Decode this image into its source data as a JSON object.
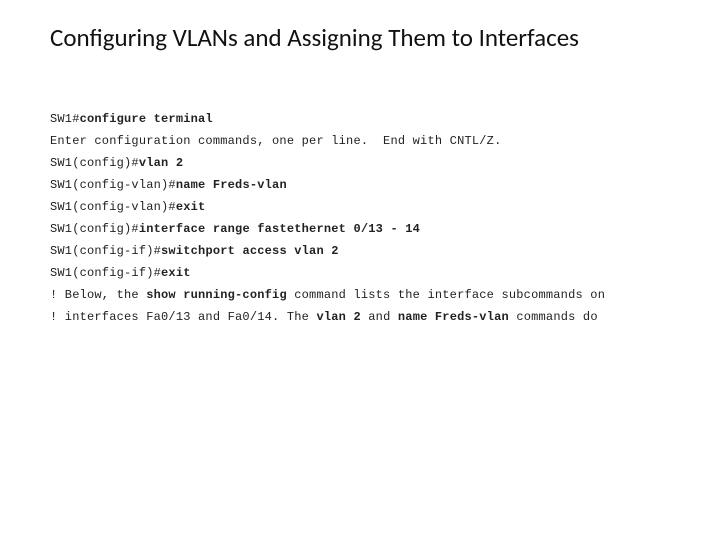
{
  "title": "Configuring VLANs and Assigning Them to Interfaces",
  "lines": [
    {
      "segments": [
        {
          "t": "SW1#"
        },
        {
          "t": "configure terminal",
          "b": true
        }
      ]
    },
    {
      "segments": [
        {
          "t": "Enter configuration commands, one per line.  End with CNTL/Z."
        }
      ]
    },
    {
      "segments": [
        {
          "t": "SW1(config)#"
        },
        {
          "t": "vlan 2",
          "b": true
        }
      ]
    },
    {
      "segments": [
        {
          "t": "SW1(config-vlan)#"
        },
        {
          "t": "name Freds-vlan",
          "b": true
        }
      ]
    },
    {
      "segments": [
        {
          "t": "SW1(config-vlan)#"
        },
        {
          "t": "exit",
          "b": true
        }
      ]
    },
    {
      "segments": [
        {
          "t": "SW1(config)#"
        },
        {
          "t": "interface range fastethernet 0/13 - 14",
          "b": true
        }
      ]
    },
    {
      "segments": [
        {
          "t": "SW1(config-if)#"
        },
        {
          "t": "switchport access vlan 2",
          "b": true
        }
      ]
    },
    {
      "segments": [
        {
          "t": "SW1(config-if)#"
        },
        {
          "t": "exit",
          "b": true
        }
      ]
    },
    {
      "segments": [
        {
          "t": "! Below, the "
        },
        {
          "t": "show running-config",
          "b": true
        },
        {
          "t": " command lists the interface subcommands on"
        }
      ]
    },
    {
      "segments": [
        {
          "t": "! interfaces Fa0/13 and Fa0/14. The "
        },
        {
          "t": "vlan 2",
          "b": true
        },
        {
          "t": " and "
        },
        {
          "t": "name Freds-vlan",
          "b": true
        },
        {
          "t": " commands do"
        }
      ]
    }
  ]
}
